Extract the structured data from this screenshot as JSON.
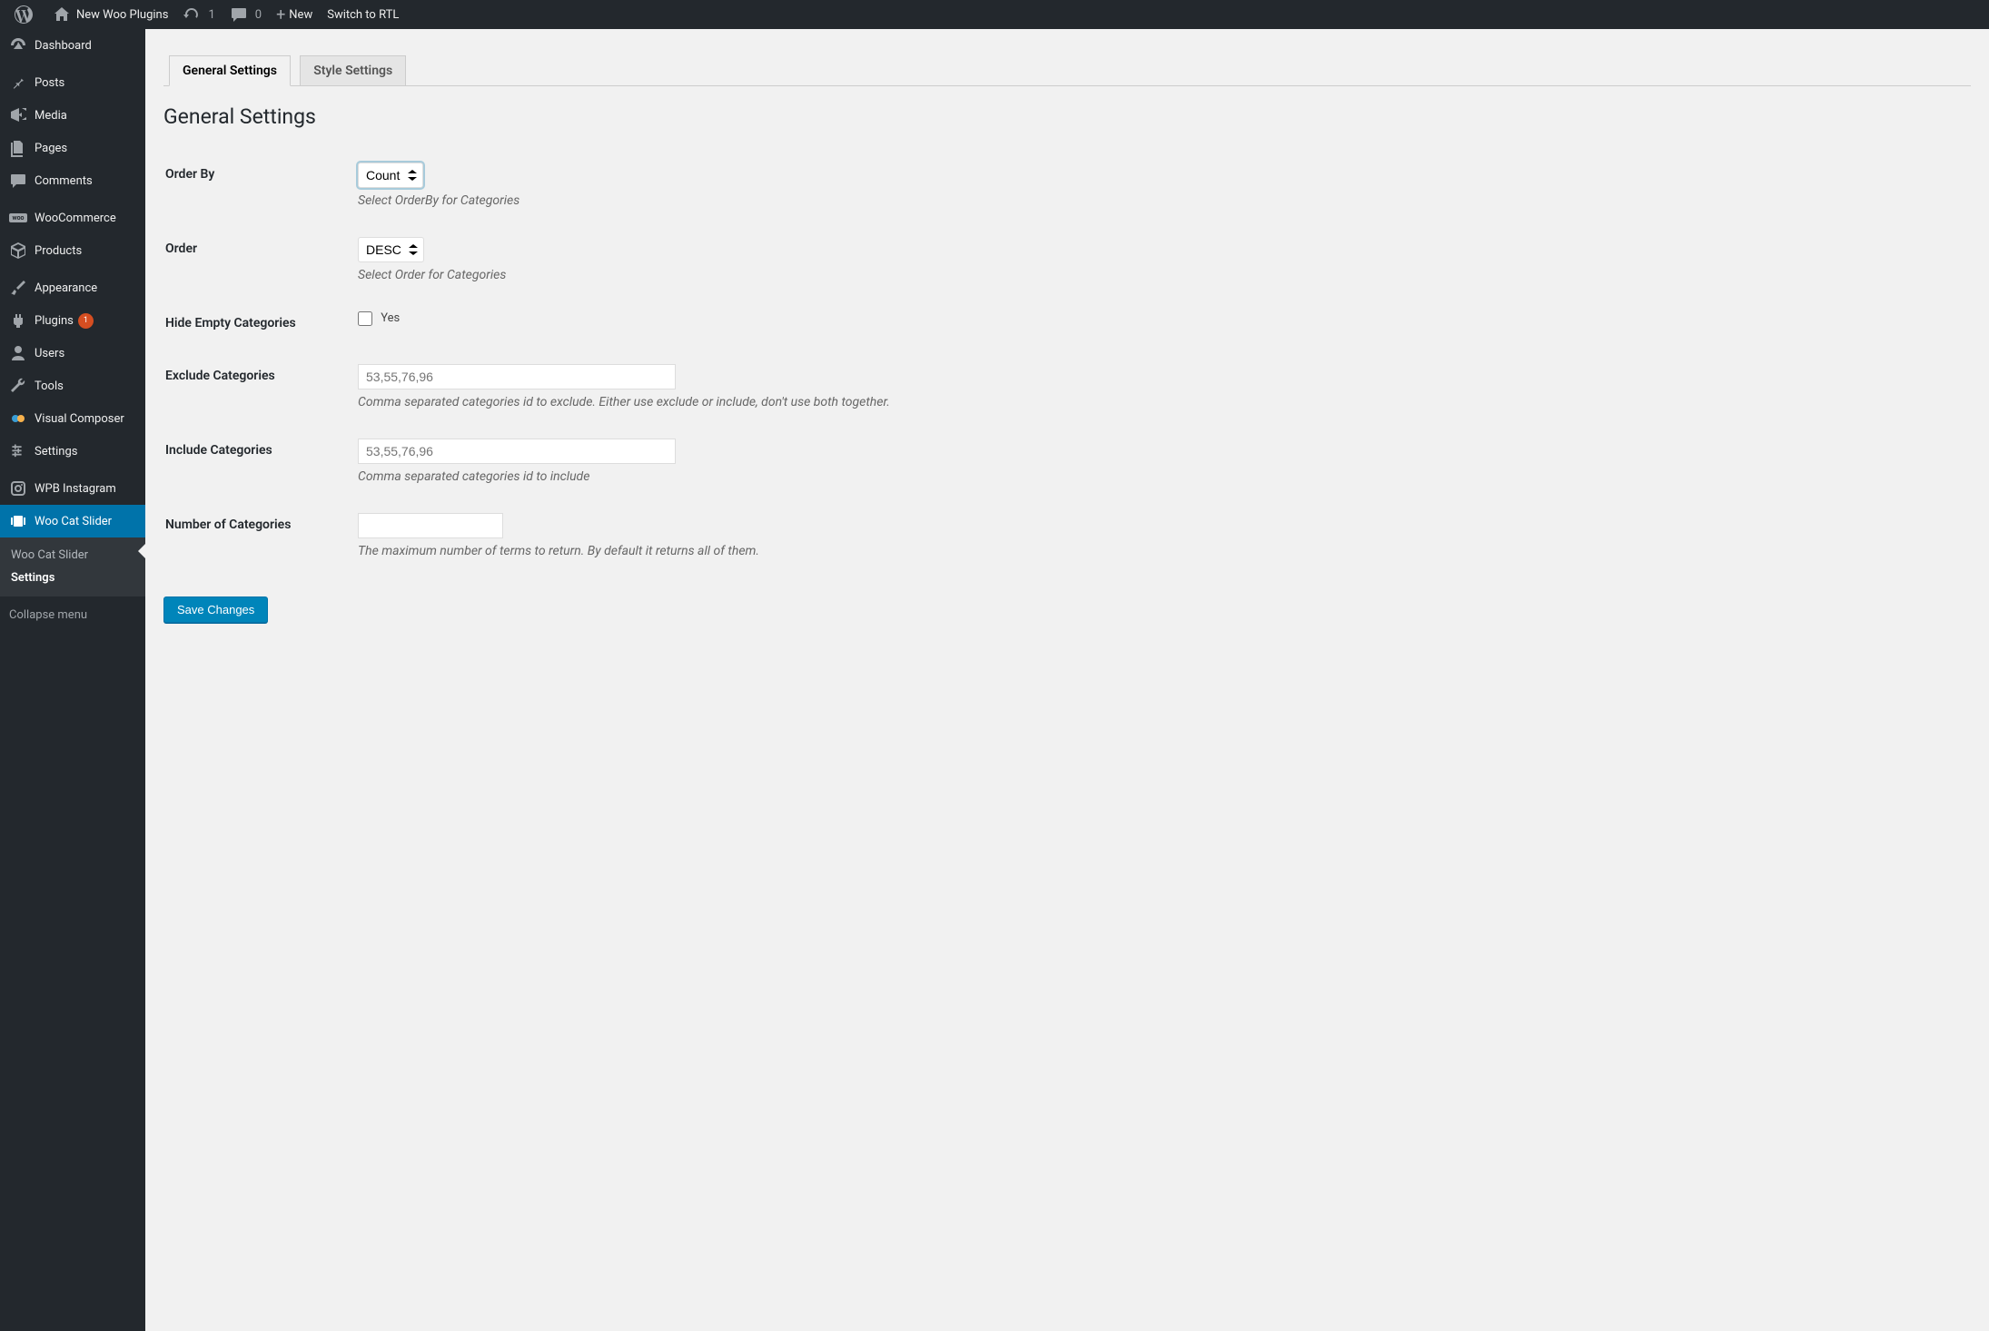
{
  "adminbar": {
    "site_name": "New Woo Plugins",
    "updates_count": "1",
    "comments_count": "0",
    "new_label": "New",
    "rtl_label": "Switch to RTL"
  },
  "sidebar": {
    "items": [
      {
        "label": "Dashboard",
        "icon": "dashboard"
      },
      {
        "label": "Posts",
        "icon": "pin"
      },
      {
        "label": "Media",
        "icon": "media"
      },
      {
        "label": "Pages",
        "icon": "pages"
      },
      {
        "label": "Comments",
        "icon": "comment"
      },
      {
        "label": "WooCommerce",
        "icon": "woo"
      },
      {
        "label": "Products",
        "icon": "products"
      },
      {
        "label": "Appearance",
        "icon": "brush"
      },
      {
        "label": "Plugins",
        "icon": "plug",
        "badge": "1"
      },
      {
        "label": "Users",
        "icon": "user"
      },
      {
        "label": "Tools",
        "icon": "wrench"
      },
      {
        "label": "Visual Composer",
        "icon": "vc"
      },
      {
        "label": "Settings",
        "icon": "settings"
      },
      {
        "label": "WPB Instagram",
        "icon": "instagram"
      },
      {
        "label": "Woo Cat Slider",
        "icon": "slider",
        "current": true
      }
    ],
    "submenu": [
      {
        "label": "Woo Cat Slider"
      },
      {
        "label": "Settings",
        "current": true
      }
    ],
    "collapse_label": "Collapse menu"
  },
  "tabs": [
    {
      "label": "General Settings",
      "active": true
    },
    {
      "label": "Style Settings",
      "active": false
    }
  ],
  "content": {
    "heading": "General Settings",
    "fields": {
      "order_by": {
        "label": "Order By",
        "value": "Count",
        "help": "Select OrderBy for Categories"
      },
      "order": {
        "label": "Order",
        "value": "DESC",
        "help": "Select Order for Categories"
      },
      "hide_empty": {
        "label": "Hide Empty Categories",
        "checkbox_label": "Yes"
      },
      "exclude": {
        "label": "Exclude Categories",
        "placeholder": "53,55,76,96",
        "help": "Comma separated categories id to exclude. Either use exclude or include, don't use both together."
      },
      "include": {
        "label": "Include Categories",
        "placeholder": "53,55,76,96",
        "help": "Comma separated categories id to include"
      },
      "number": {
        "label": "Number of Categories",
        "help": "The maximum number of terms to return. By default it returns all of them."
      }
    },
    "submit_label": "Save Changes"
  }
}
